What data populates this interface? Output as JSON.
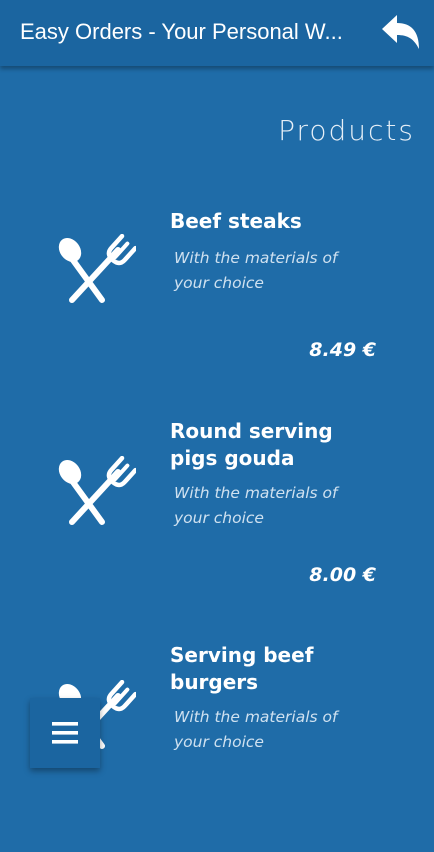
{
  "appbar": {
    "title": "Easy Orders - Your Personal W..."
  },
  "section": {
    "title": "Products"
  },
  "products": [
    {
      "name": "Beef steaks",
      "description": "With the materials of your choice",
      "price": "8.49 €"
    },
    {
      "name": "Round serving pigs gouda",
      "description": "With the materials of your choice",
      "price": "8.00 €"
    },
    {
      "name": "Serving beef burgers",
      "description": "With the materials of your choice",
      "price": ""
    }
  ],
  "icons": {
    "back": "reply-arrow-icon",
    "product": "spoon-fork-icon",
    "menu": "hamburger-menu-icon"
  },
  "colors": {
    "background": "#1f6ca8",
    "appbar": "#1b65a0",
    "text": "#ffffff",
    "muted_text": "#cfe1f0"
  }
}
